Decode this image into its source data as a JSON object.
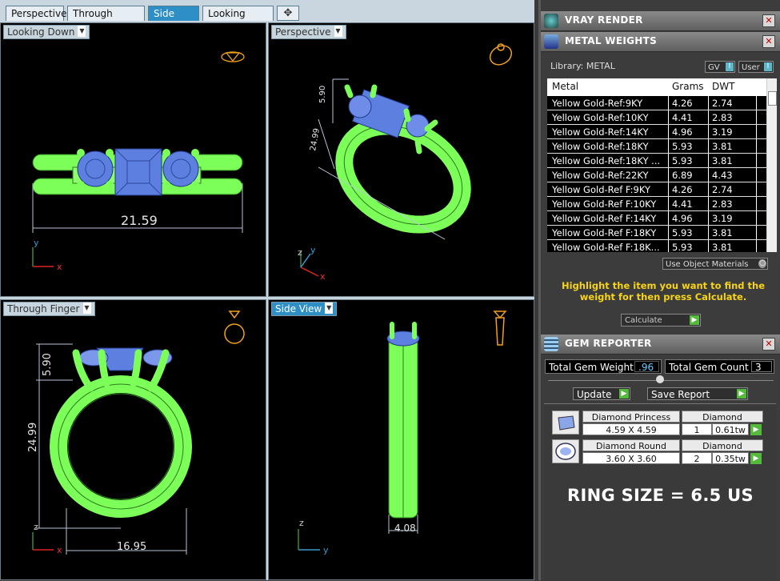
{
  "tabs": [
    "Perspective",
    "Through Finger",
    "Side View",
    "Looking Down"
  ],
  "tab_add": "✥",
  "viewports": {
    "top_left": {
      "label": "Looking Down",
      "dimension": "21.59",
      "axis1": "y",
      "axis2": "x"
    },
    "top_right": {
      "label": "Perspective",
      "dim1": "5.90",
      "dim2": "24.99",
      "axis1": "z",
      "axis2": "y",
      "axis3": "x"
    },
    "bottom_left": {
      "label": "Through Finger",
      "dim_top": "5.90",
      "dim_left": "24.99",
      "dim_bottom": "16.95",
      "axis1": "z",
      "axis2": "x"
    },
    "bottom_right": {
      "label": "Side View",
      "dimension": "4.08",
      "axis1": "z",
      "axis2": "y"
    }
  },
  "vray": {
    "title": "VRAY RENDER"
  },
  "metal_weights": {
    "title": "METAL WEIGHTS",
    "library_label": "Library: METAL",
    "gv_label": "GV",
    "user_label": "User",
    "toggle_char": "I",
    "columns": [
      "Metal",
      "Grams",
      "DWT"
    ],
    "rows": [
      [
        "Yellow Gold-Ref:9KY",
        "4.26",
        "2.74"
      ],
      [
        "Yellow Gold-Ref:10KY",
        "4.41",
        "2.83"
      ],
      [
        "Yellow Gold-Ref:14KY",
        "4.96",
        "3.19"
      ],
      [
        "Yellow Gold-Ref:18KY",
        "5.93",
        "3.81"
      ],
      [
        "Yellow Gold-Ref:18KY ...",
        "5.93",
        "3.81"
      ],
      [
        "Yellow Gold-Ref:22KY",
        "6.89",
        "4.43"
      ],
      [
        "Yellow Gold-Ref F:9KY",
        "4.26",
        "2.74"
      ],
      [
        "Yellow Gold-Ref F:10KY",
        "4.41",
        "2.83"
      ],
      [
        "Yellow Gold-Ref F:14KY",
        "4.96",
        "3.19"
      ],
      [
        "Yellow Gold-Ref F:18KY",
        "5.93",
        "3.81"
      ],
      [
        "Yellow Gold-Ref F:18K...",
        "5.93",
        "3.81"
      ]
    ],
    "use_object_materials": "Use Object Materials",
    "hint": "Highlight the item you want to find the weight for then press Calculate.",
    "calculate": "Calculate"
  },
  "gem_reporter": {
    "title": "GEM REPORTER",
    "total_weight_label": "Total Gem Weight",
    "total_weight_value": ".96",
    "total_count_label": "Total Gem Count",
    "total_count_value": "3",
    "update": "Update",
    "save_report": "Save Report",
    "gems": [
      {
        "name": "Diamond Princess",
        "material": "Diamond",
        "size": "4.59 X 4.59",
        "count": "1",
        "weight": "0.61tw"
      },
      {
        "name": "Diamond Round",
        "material": "Diamond",
        "size": "3.60 X 3.60",
        "count": "2",
        "weight": "0.35tw"
      }
    ]
  },
  "ring_size": "RING SIZE = 6.5 US",
  "colors": {
    "ring_green": "#7dff5a",
    "gem_blue": "#5d7fe0",
    "accent_blue": "#2e8fc7",
    "hint_yellow": "#f7d417"
  }
}
